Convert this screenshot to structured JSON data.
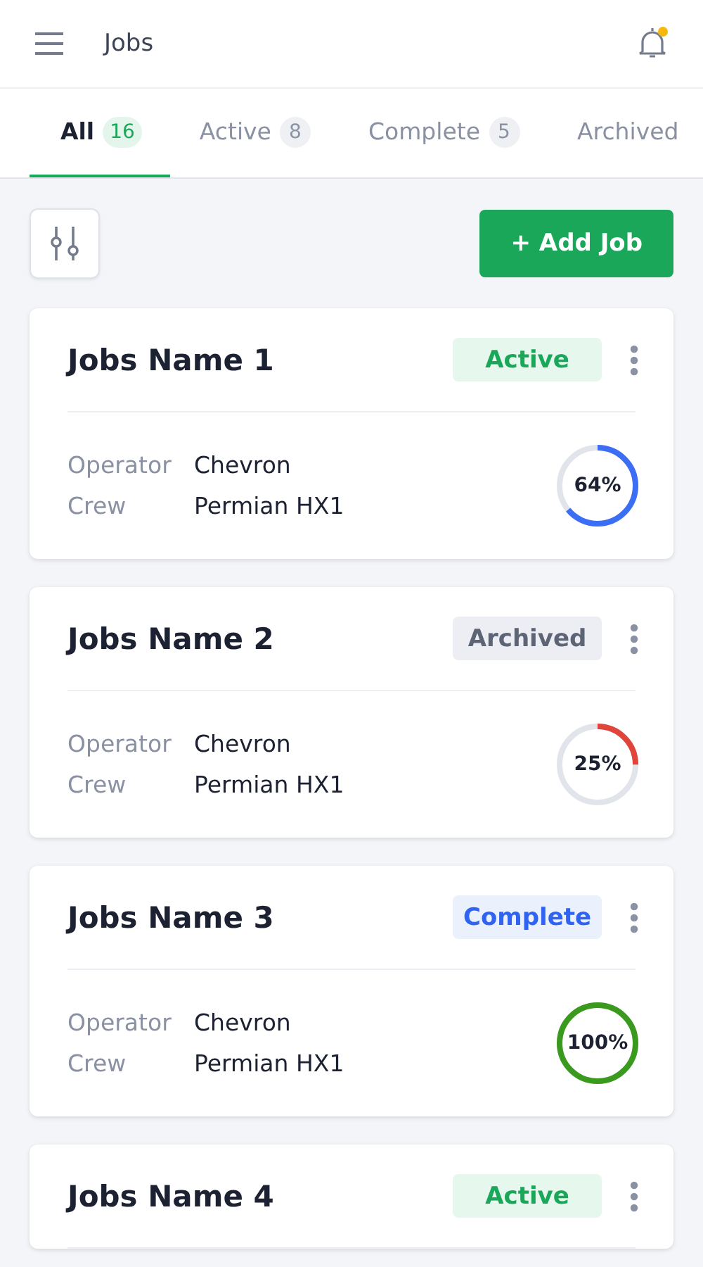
{
  "header": {
    "title": "Jobs",
    "notification_dot": true
  },
  "tabs": [
    {
      "label": "All",
      "count": "16",
      "selected": true
    },
    {
      "label": "Active",
      "count": "8",
      "selected": false
    },
    {
      "label": "Complete",
      "count": "5",
      "selected": false
    },
    {
      "label": "Archived",
      "selected": false
    }
  ],
  "add_button": "+ Add Job",
  "jobs": [
    {
      "name": "Jobs Name 1",
      "status": {
        "kind": "active",
        "label": "Active"
      },
      "fields": [
        {
          "label": "Operator",
          "value": "Chevron"
        },
        {
          "label": "Crew",
          "value": "Permian HX1"
        }
      ],
      "progress": {
        "level": 0.64,
        "reading": "64%",
        "color": "#3b6ef5"
      }
    },
    {
      "name": "Jobs Name 2",
      "status": {
        "kind": "archived",
        "label": "Archived"
      },
      "fields": [
        {
          "label": "Operator",
          "value": "Chevron"
        },
        {
          "label": "Crew",
          "value": "Permian HX1"
        }
      ],
      "progress": {
        "level": 0.25,
        "reading": "25%",
        "color": "#e0443a"
      }
    },
    {
      "name": "Jobs Name 3",
      "status": {
        "kind": "complete",
        "label": "Complete"
      },
      "fields": [
        {
          "label": "Operator",
          "value": "Chevron"
        },
        {
          "label": "Crew",
          "value": "Permian HX1"
        }
      ],
      "progress": {
        "level": 1,
        "reading": "100%",
        "color": "#3a9a1e"
      }
    },
    {
      "name": "Jobs Name 4",
      "status": {
        "kind": "active",
        "label": "Active"
      }
    }
  ]
}
